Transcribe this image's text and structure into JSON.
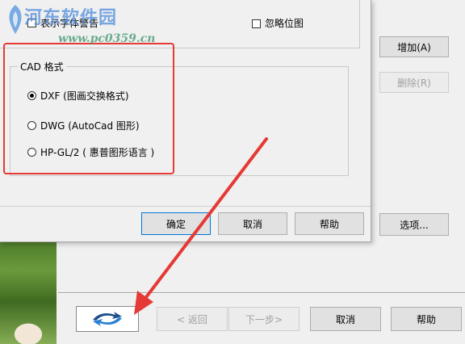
{
  "watermark": {
    "text": "河东软件园",
    "sub": "www.pc0359.cn"
  },
  "dialog": {
    "top_checkbox_label": "表示字体警告",
    "ignore_bitmap_label": "忽略位图",
    "cad_group_title": "CAD 格式",
    "options": [
      {
        "label": "DXF (图画交换格式)",
        "checked": true
      },
      {
        "label": "DWG (AutoCad 图形)",
        "checked": false
      },
      {
        "label": "HP-GL/2 ( 惠普图形语言 )",
        "checked": false
      }
    ],
    "ok_label": "确定",
    "cancel_label": "取消",
    "help_label": "帮助"
  },
  "side_panel": {
    "add_label": "增加(A)",
    "remove_label": "删除(R)",
    "options_label": "选项..."
  },
  "wizard": {
    "back_label": "< 返回",
    "next_label": "下一步>",
    "cancel_label": "取消",
    "help_label": "帮助"
  },
  "colors": {
    "highlight": "#e53935",
    "accent": "#0078d7"
  }
}
